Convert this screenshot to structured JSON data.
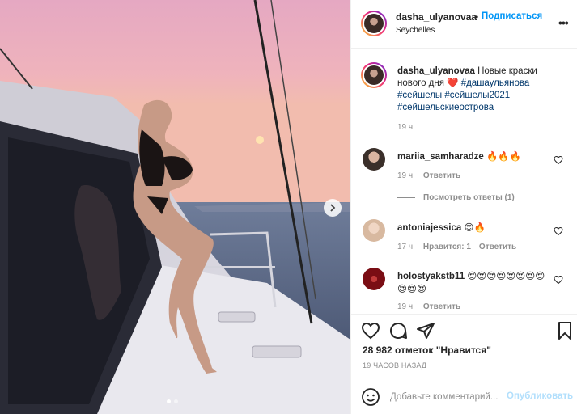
{
  "header": {
    "username": "dasha_ulyanovaa",
    "separator": "•",
    "follow_label": "Подписаться",
    "location": "Seychelles",
    "more_label": "•••"
  },
  "caption": {
    "username": "dasha_ulyanovaa",
    "text": "Новые краски нового дня",
    "emoji": "❤️",
    "hashtags": [
      "#дашаульянова",
      "#сейшелы",
      "#сейшелы2021",
      "#сейшельскиеострова"
    ],
    "time": "19 ч."
  },
  "comments": [
    {
      "username": "mariia_samharadze",
      "text": "🔥🔥🔥",
      "time": "19 ч.",
      "reply_label": "Ответить",
      "likes_label": "",
      "avatar_color": "#3a2f2a"
    },
    {
      "username": "antoniajessica",
      "text": "😍🔥",
      "time": "17 ч.",
      "likes_label": "Нравится: 1",
      "reply_label": "Ответить",
      "avatar_color": "#d8b9a0"
    },
    {
      "username": "holostyakstb11",
      "text": "😍😍😍😍😍😍😍😍😍😍😍",
      "time": "19 ч.",
      "reply_label": "Ответить",
      "likes_label": "",
      "avatar_color": "#7a0d14"
    }
  ],
  "view_replies_label": "Посмотреть ответы (1)",
  "post": {
    "likes": "28 982 отметок \"Нравится\"",
    "posted_ago": "19 ЧАСОВ НАЗАД"
  },
  "composer": {
    "placeholder": "Добавьте комментарий...",
    "publish_label": "Опубликовать"
  },
  "colors": {
    "link": "#0095f6",
    "hashtag": "#00376b",
    "muted": "#8e8e8e"
  },
  "photo": {
    "slide_count": 2,
    "active_slide": 1
  }
}
